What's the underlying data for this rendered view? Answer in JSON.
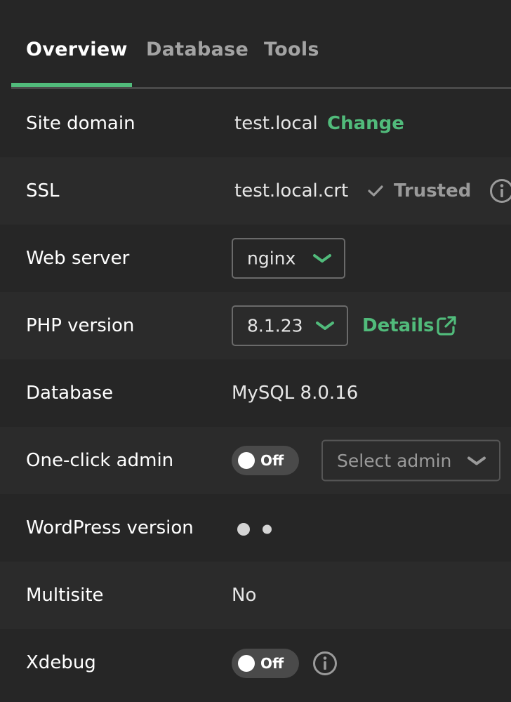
{
  "tabs": [
    {
      "label": "Overview",
      "active": true
    },
    {
      "label": "Database",
      "active": false
    },
    {
      "label": "Tools",
      "active": false
    }
  ],
  "rows": {
    "site_domain": {
      "label": "Site domain",
      "value": "test.local",
      "action": "Change"
    },
    "ssl": {
      "label": "SSL",
      "value": "test.local.crt",
      "status": "Trusted",
      "status_icon": "check-icon",
      "info_icon": "info-icon"
    },
    "web_server": {
      "label": "Web server",
      "selected": "nginx"
    },
    "php_version": {
      "label": "PHP version",
      "selected": "8.1.23",
      "action": "Details",
      "action_icon": "external-link-icon"
    },
    "database": {
      "label": "Database",
      "value": "MySQL 8.0.16"
    },
    "one_click_admin": {
      "label": "One-click admin",
      "toggle": "Off",
      "select_placeholder": "Select admin"
    },
    "wordpress_version": {
      "label": "WordPress version",
      "loading_icon": "loading-dots-icon"
    },
    "multisite": {
      "label": "Multisite",
      "value": "No"
    },
    "xdebug": {
      "label": "Xdebug",
      "toggle": "Off",
      "info_icon": "info-icon"
    }
  },
  "colors": {
    "background": "#262626",
    "row_alt": "#2b2b2b",
    "accent": "#51bb7b",
    "muted_text": "#9a9a9a"
  }
}
